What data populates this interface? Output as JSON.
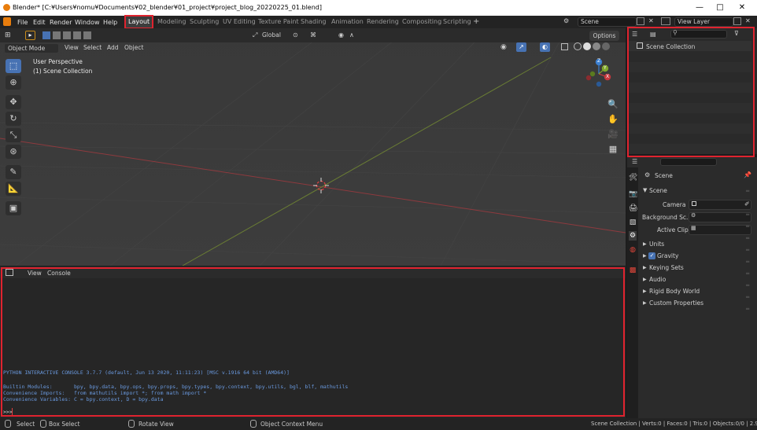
{
  "window": {
    "title": "Blender* [C:¥Users¥nomu¥Documents¥02_blender¥01_project¥project_blog_20220225_01.blend]",
    "minimize": "—",
    "maximize": "□",
    "close": "✕"
  },
  "menu": [
    "File",
    "Edit",
    "Render",
    "Window",
    "Help"
  ],
  "workspaces": [
    {
      "label": "Layout",
      "active": true
    },
    {
      "label": "Modeling"
    },
    {
      "label": "Sculpting"
    },
    {
      "label": "UV Editing"
    },
    {
      "label": "Texture Paint"
    },
    {
      "label": "Shading"
    },
    {
      "label": "Animation"
    },
    {
      "label": "Rendering"
    },
    {
      "label": "Compositing"
    },
    {
      "label": "Scripting"
    }
  ],
  "add_workspace": "+",
  "scene_selector": {
    "value": "Scene"
  },
  "view_layer_selector": {
    "value": "View Layer"
  },
  "viewport_header": {
    "transform_orientation": "Global",
    "options_label": "Options"
  },
  "viewport_menu": {
    "mode": "Object Mode",
    "items": [
      "View",
      "Select",
      "Add",
      "Object"
    ]
  },
  "viewport_overlay": {
    "perspective": "User Perspective",
    "collection": "(1) Scene Collection"
  },
  "gizmo": {
    "x": "X",
    "y": "Y",
    "z": "Z"
  },
  "outliner": {
    "items": [
      {
        "label": "Scene Collection"
      }
    ]
  },
  "properties": {
    "scene_name": "Scene",
    "section_scene": "Scene",
    "camera_label": "Camera",
    "background_scene_label": "Background Sc...",
    "active_clip_label": "Active Clip",
    "panels": [
      {
        "label": "Units"
      },
      {
        "label": "Gravity",
        "checkbox": true
      },
      {
        "label": "Keying Sets"
      },
      {
        "label": "Audio"
      },
      {
        "label": "Rigid Body World"
      },
      {
        "label": "Custom Properties"
      }
    ]
  },
  "console": {
    "menu": [
      "View",
      "Console"
    ],
    "lines": [
      "PYTHON INTERACTIVE CONSOLE 3.7.7 (default, Jun 13 2020, 11:11:23) [MSC v.1916 64 bit (AMD64)]",
      "",
      "Builtin Modules:       bpy, bpy.data, bpy.ops, bpy.props, bpy.types, bpy.context, bpy.utils, bgl, blf, mathutils",
      "Convenience Imports:   from mathutils import *; from math import *",
      "Convenience Variables: C = bpy.context, D = bpy.data"
    ],
    "prompt": ">>> "
  },
  "statusbar": {
    "select": "Select",
    "box_select": "Box Select",
    "rotate_view": "Rotate View",
    "context_menu": "Object Context Menu",
    "stats": "Scene Collection | Verts:0 | Faces:0 | Tris:0 | Objects:0/0 | 2.92.0"
  },
  "colors": {
    "accent": "#4772b3",
    "highlight_box": "#e0232f",
    "x_axis": "#c8383d",
    "y_axis": "#80a62b",
    "z_axis": "#3b7fd0"
  }
}
